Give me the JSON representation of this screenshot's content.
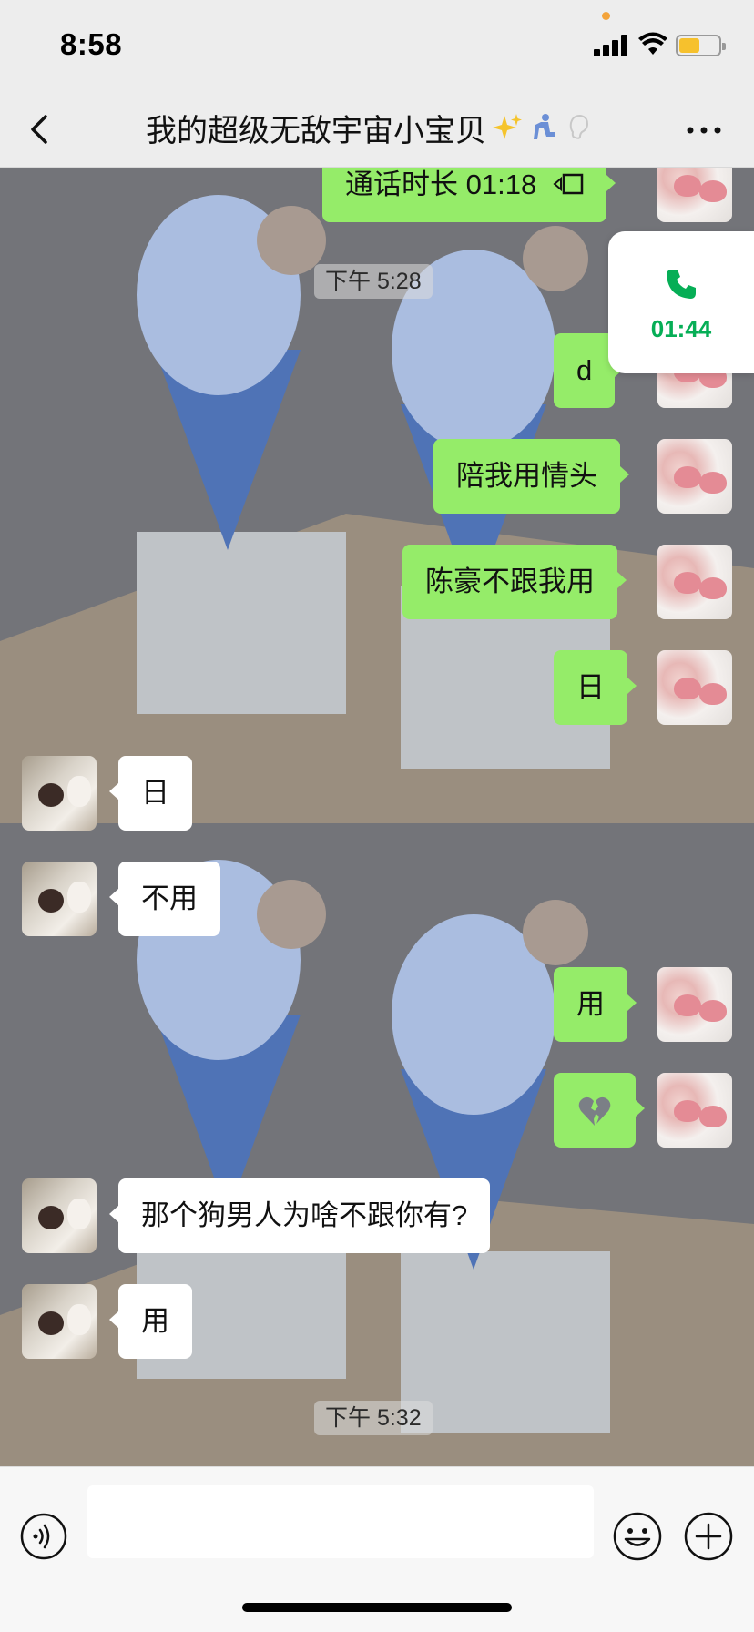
{
  "status_bar": {
    "time": "8:58"
  },
  "nav": {
    "title": "我的超级无敌宇宙小宝贝",
    "title_emoji": [
      "sparkles-icon",
      "person-in-chair-icon",
      "ear-icon"
    ]
  },
  "floating_call": {
    "duration": "01:44",
    "icon": "phone-icon"
  },
  "messages": [
    {
      "side": "me",
      "text": "通话时长 01:18",
      "icon": "video-call-icon"
    },
    {
      "type": "time",
      "text": "下午 5:28"
    },
    {
      "side": "me",
      "text": "d"
    },
    {
      "side": "me",
      "text": "陪我用情头"
    },
    {
      "side": "me",
      "text": "陈豪不跟我用"
    },
    {
      "side": "me",
      "text": "日"
    },
    {
      "side": "them",
      "text": "日"
    },
    {
      "side": "them",
      "text": "不用"
    },
    {
      "side": "me",
      "text": "用"
    },
    {
      "side": "me",
      "emoji": "broken-heart-icon"
    },
    {
      "side": "them",
      "text": "那个狗男人为啥不跟你有?"
    },
    {
      "side": "them",
      "text": "用"
    },
    {
      "type": "time",
      "text": "下午 5:32"
    }
  ],
  "input": {
    "value": "",
    "placeholder": ""
  },
  "colors": {
    "my_bubble": "#95ec69",
    "their_bubble": "#ffffff",
    "call_green": "#06ae56",
    "battery": "#f6c12d"
  }
}
